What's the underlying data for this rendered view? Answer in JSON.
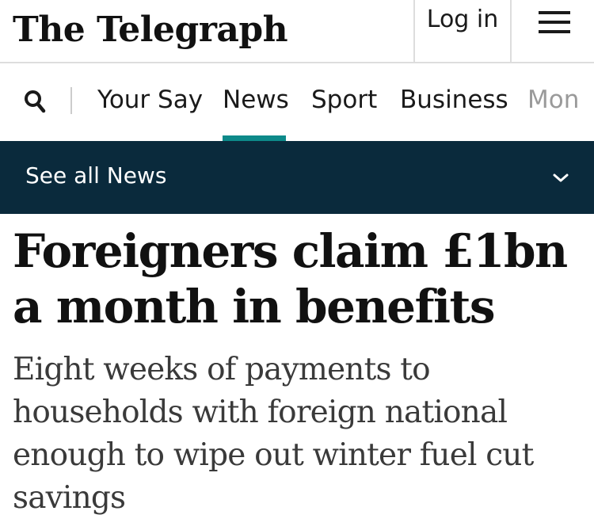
{
  "header": {
    "logo_text": "The Telegraph",
    "login_label": "Log in",
    "menu_icon": "hamburger-icon"
  },
  "nav": {
    "search_icon": "search-icon",
    "items": [
      {
        "label": "Your Say",
        "active": false
      },
      {
        "label": "News",
        "active": true
      },
      {
        "label": "Sport",
        "active": false
      },
      {
        "label": "Business",
        "active": false
      },
      {
        "label": "Mon",
        "active": false
      }
    ],
    "active_color": "#0d8a8a"
  },
  "section_bar": {
    "label": "See all News",
    "icon": "chevron-down-icon",
    "background": "#0a2a3c"
  },
  "article": {
    "headline": "Foreigners claim £1bn a month in benefits",
    "standfirst": "Eight weeks of payments to households with foreign national enough to wipe out winter fuel cut savings"
  }
}
